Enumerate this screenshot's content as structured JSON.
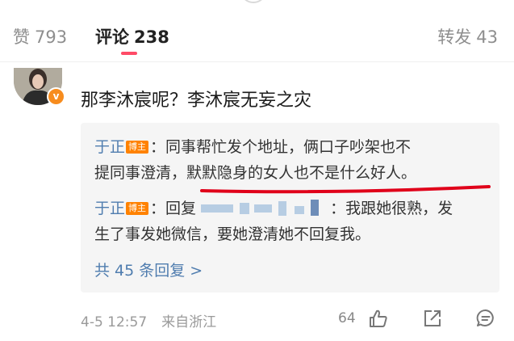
{
  "tabs": {
    "like_label": "赞",
    "like_count": "793",
    "comment_label": "评论",
    "comment_count": "238",
    "repost_label": "转发",
    "repost_count": "43"
  },
  "comment": {
    "text": "那李沐宸呢？李沐宸无妄之灾"
  },
  "replies": [
    {
      "author": "于正",
      "tag": "博主",
      "text_line1": "：同事帮忙发个地址，俩口子吵架也不",
      "text_line2": "提同事澄清，默默隐身的女人也不是什么好人。"
    },
    {
      "author": "于正",
      "tag": "博主",
      "reply_prefix": "：回复 ",
      "text_tail": "：我跟她很熟，发",
      "text_line2": "生了事发她微信，要她澄清她不回复我。"
    }
  ],
  "more_replies": "共 45 条回复 >",
  "footer": {
    "date": "4-5 12:57",
    "location": "来自浙江",
    "like_count": "64"
  },
  "colors": {
    "accent": "#ff4b67",
    "link": "#507daf",
    "tag": "#ff8200",
    "annotation": "#e0001a"
  }
}
